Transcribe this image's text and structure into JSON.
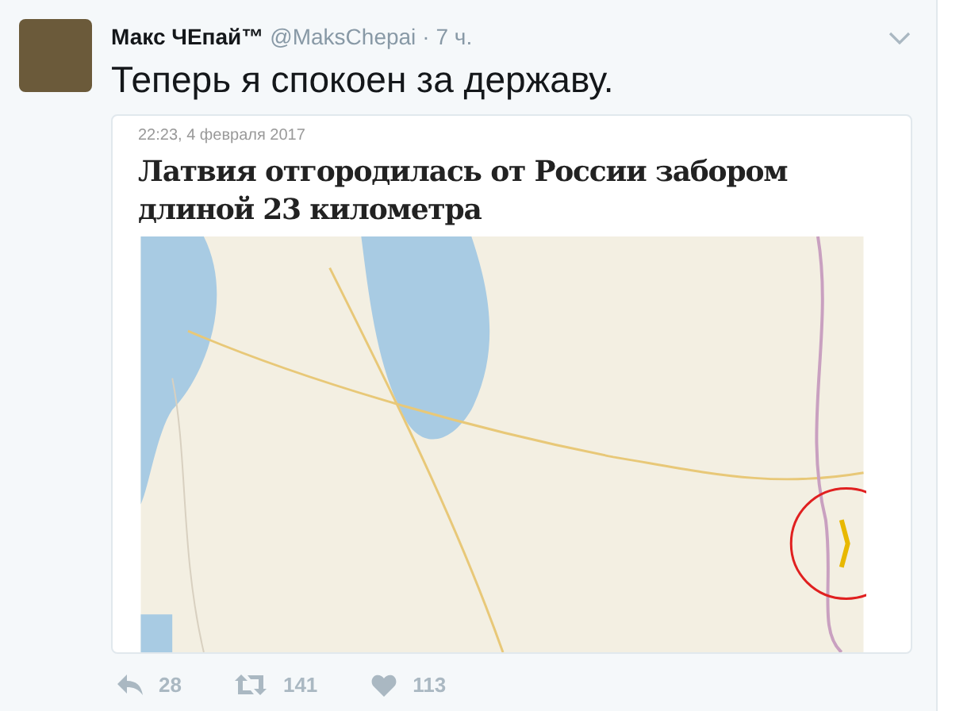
{
  "tweet": {
    "display_name": "Макс ЧЕпай™",
    "handle": "@MaksChepai",
    "time": "· 7 ч.",
    "text": "Теперь я спокоен за державу.",
    "embed": {
      "timestamp": "22:23, 4 февраля 2017",
      "headline": "Латвия отгородилась от России забором длиной 23 километра"
    },
    "actions": [
      {
        "kind": "reply",
        "count": "28"
      },
      {
        "kind": "retweet",
        "count": "141"
      },
      {
        "kind": "like",
        "count": "113"
      }
    ]
  }
}
